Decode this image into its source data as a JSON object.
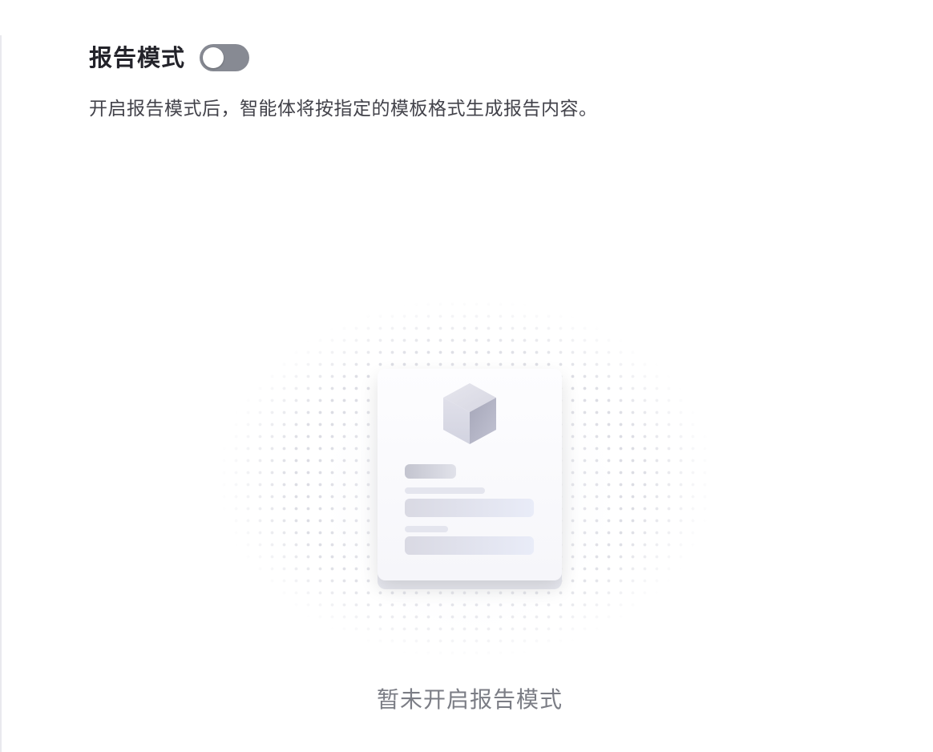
{
  "report_mode": {
    "title": "报告模式",
    "toggle_enabled": false,
    "description": "开启报告模式后，智能体将按指定的模板格式生成报告内容。"
  },
  "empty_state": {
    "icon": "report-document-cube-icon",
    "message": "暂未开启报告模式"
  },
  "colors": {
    "toggle_off": "#878a93",
    "title": "#23232a",
    "description": "#42424a",
    "empty_text": "#7b7d85"
  }
}
